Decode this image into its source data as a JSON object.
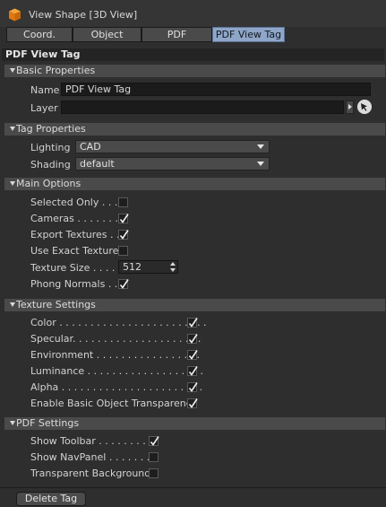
{
  "window": {
    "title": "View Shape [3D View]"
  },
  "tabs": [
    {
      "label": "Coord."
    },
    {
      "label": "Object"
    },
    {
      "label": "PDF"
    },
    {
      "label": "PDF View Tag",
      "active": true
    }
  ],
  "panel": {
    "title": "PDF View Tag"
  },
  "basic": {
    "header": "Basic Properties",
    "name_label": "Name",
    "name_value": "PDF View Tag",
    "layer_label": "Layer",
    "layer_value": ""
  },
  "tag": {
    "header": "Tag Properties",
    "lighting_label": "Lighting",
    "lighting_value": "CAD",
    "shading_label": "Shading",
    "shading_value": "default"
  },
  "main": {
    "header": "Main Options",
    "selected_only": {
      "label": "Selected Only . . .",
      "checked": false
    },
    "cameras": {
      "label": "Cameras . . . . . . . .",
      "checked": true
    },
    "export_textures": {
      "label": "Export Textures . .",
      "checked": true
    },
    "use_exact_textures": {
      "label": "Use Exact Textures",
      "checked": false
    },
    "texture_size": {
      "label": "Texture Size . . . . .",
      "value": "512"
    },
    "phong_normals": {
      "label": "Phong Normals . .",
      "checked": true
    }
  },
  "texture": {
    "header": "Texture Settings",
    "color": {
      "label": "Color . . . . . . . . . . . . . . . . . . . . . . . .",
      "checked": true
    },
    "specular": {
      "label": "Specular. . . . . . . . . . . . . . . . . . . . .",
      "checked": true
    },
    "environment": {
      "label": "Environment . . . . . . . . . . . . . . . . .",
      "checked": true
    },
    "luminance": {
      "label": "Luminance . . . . . . . . . . . . . . . . . . .",
      "checked": true
    },
    "alpha": {
      "label": "Alpha . . . . . . . . . . . . . . . . . . . . . . .",
      "checked": true
    },
    "basic_transparency": {
      "label": "Enable Basic Object Transparency",
      "checked": true
    }
  },
  "pdf": {
    "header": "PDF Settings",
    "show_toolbar": {
      "label": "Show Toolbar . . . . . . . . .",
      "checked": true
    },
    "show_navpanel": {
      "label": "Show NavPanel . . . . . . . .",
      "checked": false
    },
    "transparent_bg": {
      "label": "Transparent Background",
      "checked": false
    }
  },
  "footer": {
    "delete_label": "Delete Tag"
  },
  "colors": {
    "background": "#2e2e2e",
    "group_header": "#4a4a4a",
    "active_tab": "#8fa6c8",
    "icon_orange": "#f08a1c"
  }
}
